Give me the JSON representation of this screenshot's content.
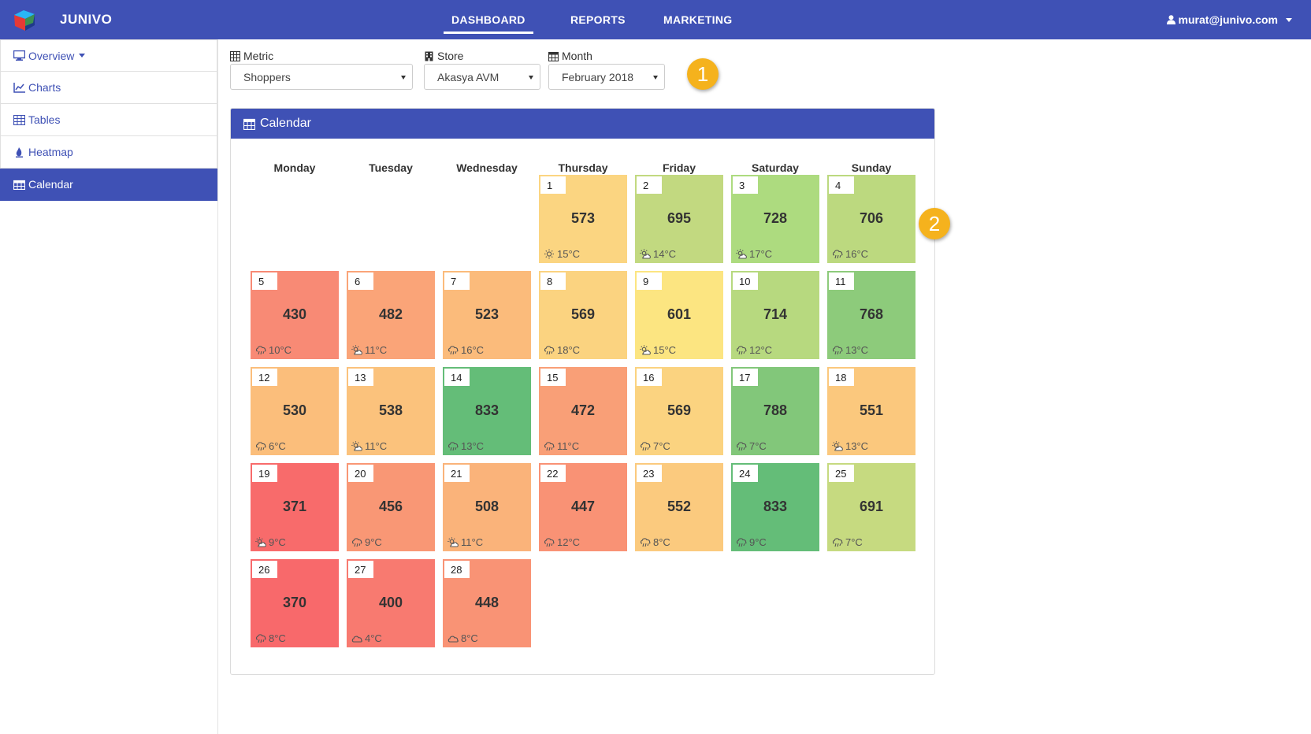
{
  "app": {
    "brand": "JUNIVO"
  },
  "nav": {
    "dashboard": "DASHBOARD",
    "reports": "REPORTS",
    "marketing": "MARKETING",
    "user": "murat@junivo.com"
  },
  "sidebar": {
    "items": [
      {
        "label": "Overview",
        "icon": "desktop-icon"
      },
      {
        "label": "Charts",
        "icon": "line-chart-icon"
      },
      {
        "label": "Tables",
        "icon": "table-icon"
      },
      {
        "label": "Heatmap",
        "icon": "fire-icon"
      },
      {
        "label": "Calendar",
        "icon": "calendar-icon"
      }
    ]
  },
  "filters": {
    "metric": {
      "label": "Metric",
      "value": "Shoppers"
    },
    "store": {
      "label": "Store",
      "value": "Akasya AVM"
    },
    "month": {
      "label": "Month",
      "value": "February 2018"
    }
  },
  "callouts": {
    "one": "1",
    "two": "2"
  },
  "calendar": {
    "title": "Calendar",
    "weekdays": [
      "Monday",
      "Tuesday",
      "Wednesday",
      "Thursday",
      "Friday",
      "Saturday",
      "Sunday"
    ],
    "days": [
      {
        "day": "1",
        "value": "573",
        "temp": "15°C",
        "weather": "sunny",
        "color": "#fbd581"
      },
      {
        "day": "2",
        "value": "695",
        "temp": "14°C",
        "weather": "partly-sunny",
        "color": "#c2d980"
      },
      {
        "day": "3",
        "value": "728",
        "temp": "17°C",
        "weather": "partly-sunny",
        "color": "#addb7f"
      },
      {
        "day": "4",
        "value": "706",
        "temp": "16°C",
        "weather": "rain",
        "color": "#bcd97f"
      },
      {
        "day": "5",
        "value": "430",
        "temp": "10°C",
        "weather": "rain",
        "color": "#f88a75"
      },
      {
        "day": "6",
        "value": "482",
        "temp": "11°C",
        "weather": "partly-sunny",
        "color": "#faa478"
      },
      {
        "day": "7",
        "value": "523",
        "temp": "16°C",
        "weather": "rain",
        "color": "#fbbb7b"
      },
      {
        "day": "8",
        "value": "569",
        "temp": "18°C",
        "weather": "rain",
        "color": "#fbd380"
      },
      {
        "day": "9",
        "value": "601",
        "temp": "15°C",
        "weather": "partly-sunny",
        "color": "#fce581"
      },
      {
        "day": "10",
        "value": "714",
        "temp": "12°C",
        "weather": "rain",
        "color": "#b7d97f"
      },
      {
        "day": "11",
        "value": "768",
        "temp": "13°C",
        "weather": "rain",
        "color": "#8dcb7b"
      },
      {
        "day": "12",
        "value": "530",
        "temp": "6°C",
        "weather": "rain",
        "color": "#fbbe7b"
      },
      {
        "day": "13",
        "value": "538",
        "temp": "11°C",
        "weather": "partly-sunny",
        "color": "#fbc27c"
      },
      {
        "day": "14",
        "value": "833",
        "temp": "13°C",
        "weather": "rain",
        "color": "#64bd78"
      },
      {
        "day": "15",
        "value": "472",
        "temp": "11°C",
        "weather": "rain",
        "color": "#f99f77"
      },
      {
        "day": "16",
        "value": "569",
        "temp": "7°C",
        "weather": "rain",
        "color": "#fbd380"
      },
      {
        "day": "17",
        "value": "788",
        "temp": "7°C",
        "weather": "rain",
        "color": "#82c77a"
      },
      {
        "day": "18",
        "value": "551",
        "temp": "13°C",
        "weather": "partly-sunny",
        "color": "#fbc87d"
      },
      {
        "day": "19",
        "value": "371",
        "temp": "9°C",
        "weather": "partly-sunny",
        "color": "#f86b6b"
      },
      {
        "day": "20",
        "value": "456",
        "temp": "9°C",
        "weather": "rain",
        "color": "#f99775"
      },
      {
        "day": "21",
        "value": "508",
        "temp": "11°C",
        "weather": "partly-sunny",
        "color": "#fab37a"
      },
      {
        "day": "22",
        "value": "447",
        "temp": "12°C",
        "weather": "rain",
        "color": "#f99275"
      },
      {
        "day": "23",
        "value": "552",
        "temp": "8°C",
        "weather": "rain",
        "color": "#fbca7e"
      },
      {
        "day": "24",
        "value": "833",
        "temp": "9°C",
        "weather": "rain",
        "color": "#64bd78"
      },
      {
        "day": "25",
        "value": "691",
        "temp": "7°C",
        "weather": "rain",
        "color": "#c6da80"
      },
      {
        "day": "26",
        "value": "370",
        "temp": "8°C",
        "weather": "rain",
        "color": "#f8696b"
      },
      {
        "day": "27",
        "value": "400",
        "temp": "4°C",
        "weather": "cloud",
        "color": "#f87a70"
      },
      {
        "day": "28",
        "value": "448",
        "temp": "8°C",
        "weather": "cloud",
        "color": "#f99375"
      }
    ]
  }
}
